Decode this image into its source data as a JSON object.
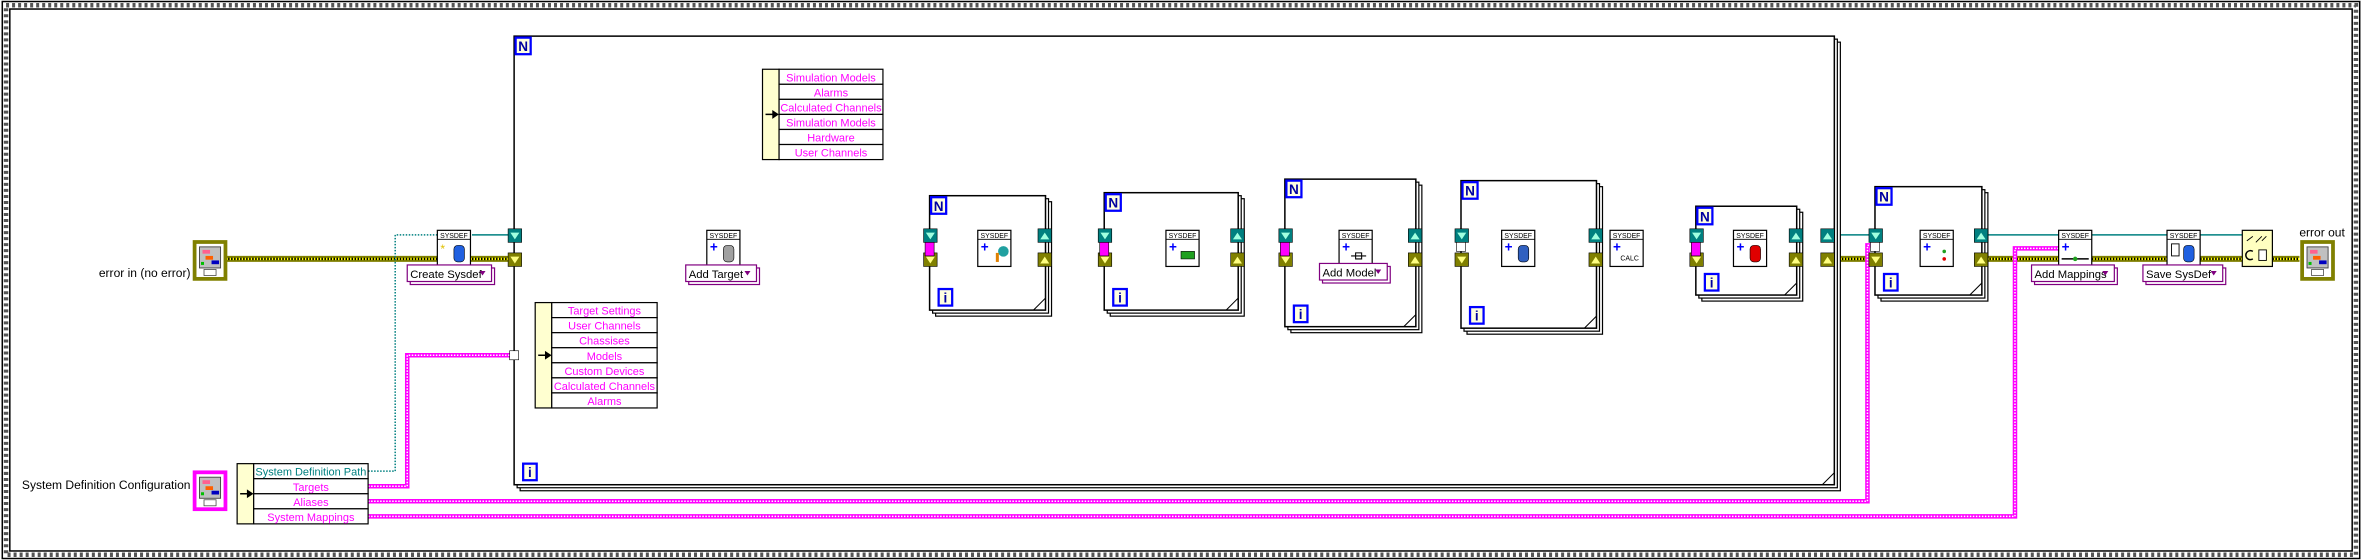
{
  "diagram": {
    "error_in_label": "error in (no error)",
    "config_label": "System Definition Configuration",
    "error_out_label": "error out",
    "config_unbundle": [
      "System Definition Path",
      "Targets",
      "Aliases",
      "System Mappings"
    ],
    "target_unbundle": [
      "Target Settings",
      "User Channels",
      "Chassises",
      "Models",
      "Custom Devices",
      "Calculated Channels",
      "Alarms"
    ],
    "settings_unbundle": [
      "Simulation Models",
      "Alarms",
      "Calculated Channels",
      "Simulation Models",
      "Hardware",
      "User Channels"
    ],
    "vi_banner": "SYSDEF",
    "calc_label": "CALC",
    "count_terminal": "N",
    "iteration_terminal": "i",
    "selectors": {
      "create": "Create Sysdef",
      "add_target": "Add Target",
      "add_model": "Add Model",
      "add_mappings": "Add Mappings",
      "save": "Save SysDef"
    },
    "icons": {
      "create": "new-sysdef-icon",
      "add_target": "add-target-icon",
      "user_channel": "add-user-channel-icon",
      "hardware": "add-hardware-icon",
      "model": "add-model-icon",
      "custom_device": "add-custom-device-icon",
      "calc": "add-calculated-channel-icon",
      "alarm": "add-alarm-icon",
      "alias": "add-alias-icon",
      "mappings": "add-mappings-icon",
      "save": "save-sysdef-icon",
      "error_handler": "simple-error-handler-icon"
    },
    "colors": {
      "cluster_wire": "#ff00ff",
      "path_wire": "#008080",
      "error_wire": "#808000",
      "terminal_border": "#0000ff",
      "selector_border": "#800080"
    }
  }
}
